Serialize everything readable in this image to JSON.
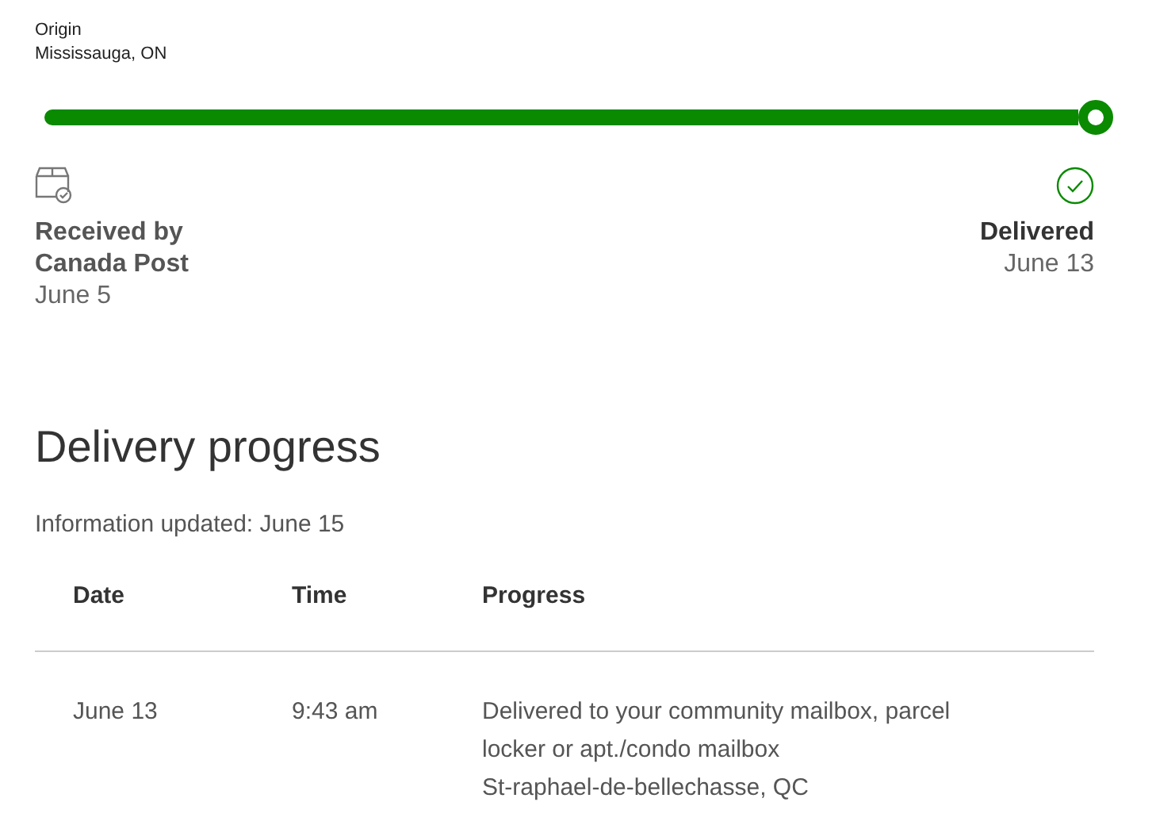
{
  "origin": {
    "label": "Origin",
    "place": "Mississauga, ON"
  },
  "tracker": {
    "level": 1
  },
  "milestones": [
    {
      "kind": "received",
      "title": "Received by Canada Post",
      "date": "June 5"
    },
    {
      "kind": "delivered",
      "title": "Delivered",
      "date": "June 13"
    }
  ],
  "progress": {
    "heading": "Delivery progress",
    "updated": "Information updated: June 15",
    "table": {
      "columns": [
        "Date",
        "Time",
        "Progress"
      ],
      "rows": [
        {
          "date": "June 13",
          "time": "9:43 am",
          "description": "Delivered to your community mailbox, parcel locker or apt./condo mailbox",
          "location": "St-raphael-de-bellechasse, QC"
        }
      ]
    }
  }
}
